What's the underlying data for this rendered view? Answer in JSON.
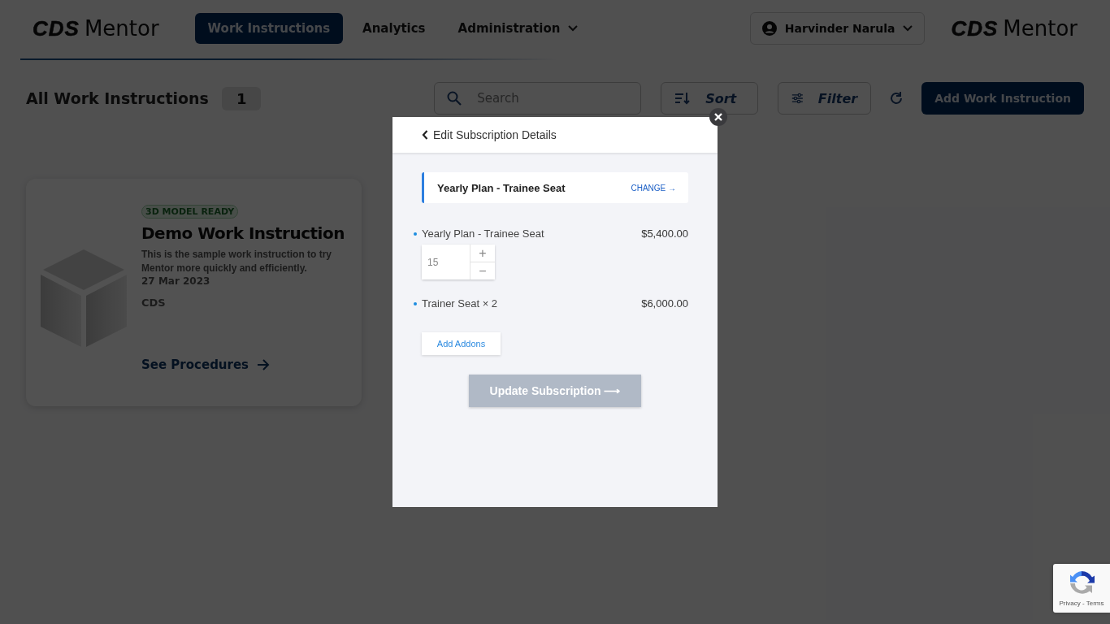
{
  "header": {
    "logo": {
      "mark": "CDS",
      "word": "Mentor"
    },
    "nav": [
      {
        "label": "Work Instructions",
        "selected": true,
        "dropdown": false
      },
      {
        "label": "Analytics",
        "selected": false,
        "dropdown": false
      },
      {
        "label": "Administration",
        "selected": false,
        "dropdown": true
      }
    ],
    "user": {
      "name": "Harvinder Narula"
    },
    "brand": {
      "mark": "CDS",
      "word": "Mentor"
    }
  },
  "toolbar": {
    "title": "All Work Instructions",
    "count": "1",
    "search": {
      "placeholder": "Search"
    },
    "sort": "Sort",
    "filter": "Filter",
    "add": "Add Work Instruction"
  },
  "cards": [
    {
      "kind": "picture",
      "badge": "3D MODEL READY",
      "title": "Demo Work Instruction",
      "description": "This is the sample work instruction to try Mentor more quickly and efficiently.",
      "date": "27 Mar 2023",
      "owner": "CDS",
      "link": "See Procedures"
    }
  ],
  "modal": {
    "title": "Edit Subscription Details",
    "plan": {
      "name": "Yearly Plan - Trainee Seat",
      "action": "CHANGE →"
    },
    "items": [
      {
        "kind": "quantity",
        "label": "Yearly Plan - Trainee Seat",
        "price": "$5,400.00",
        "quantity": "15",
        "increment": "+",
        "decrement": "−"
      },
      {
        "kind": "addon",
        "label": "Trainer Seat × 2",
        "price": "$6,000.00"
      }
    ],
    "add_button": "Add Addons",
    "submit": {
      "label": "Update Subscription ⟶",
      "disabled": true
    }
  },
  "recaptcha": {
    "text": "Privacy - Terms"
  }
}
